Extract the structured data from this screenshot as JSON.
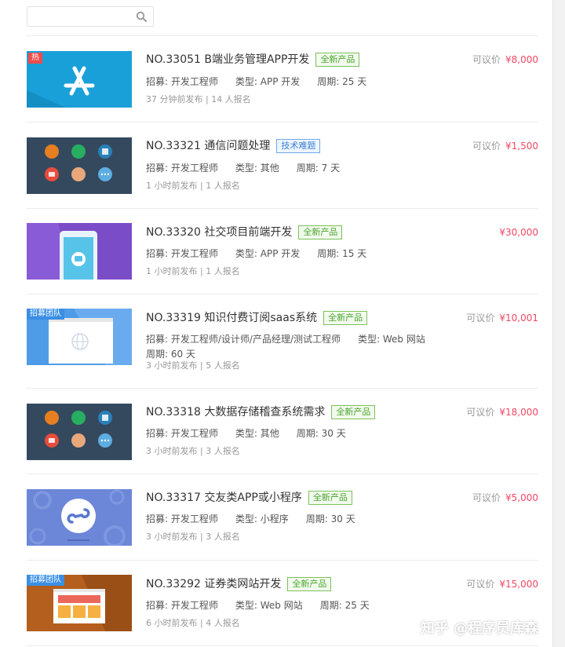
{
  "search": {
    "placeholder": ""
  },
  "watermark": "知乎 @程序员库森",
  "items": [
    {
      "title": "NO.33051 B端业务管理APP开发",
      "badge": "全新产品",
      "badge_type": "new",
      "recruit_label": "招募:",
      "recruit": "开发工程师",
      "type_label": "类型:",
      "type": "APP 开发",
      "period_label": "周期:",
      "period": "25 天",
      "time": "37 分钟前发布 | 14 人报名",
      "price_label": "可议价",
      "price": "¥8,000",
      "thumb_tag": "热",
      "thumb_icon": "app-store-icon",
      "thumb_color": "#1aa0d8"
    },
    {
      "title": "NO.33321 通信问题处理",
      "badge": "技术难题",
      "badge_type": "tech",
      "recruit_label": "招募:",
      "recruit": "开发工程师",
      "type_label": "类型:",
      "type": "其他",
      "period_label": "周期:",
      "period": "7 天",
      "time": "1 小时前发布 | 1 人报名",
      "price_label": "可议价",
      "price": "¥1,500",
      "thumb_icon": "multi-platform-icon",
      "thumb_color": "#34495e"
    },
    {
      "title": "NO.33320 社交项目前端开发",
      "badge": "全新产品",
      "badge_type": "new",
      "recruit_label": "招募:",
      "recruit": "开发工程师",
      "type_label": "类型:",
      "type": "APP 开发",
      "period_label": "周期:",
      "period": "15 天",
      "time": "1 小时前发布 | 1 人报名",
      "price_label": "",
      "price": "¥30,000",
      "thumb_icon": "phone-chat-icon",
      "thumb_color": "#8a5bd6"
    },
    {
      "title": "NO.33319 知识付费订阅saas系统",
      "badge": "全新产品",
      "badge_type": "new",
      "recruit_label": "招募:",
      "recruit": "开发工程师/设计师/产品经理/测试工程师",
      "type_label": "类型:",
      "type": "Web 网站",
      "period_label": "周期:",
      "period": "60 天",
      "time": "3 小时前发布 | 5 人报名",
      "price_label": "可议价",
      "price": "¥10,001",
      "thumb_tag": "招募团队",
      "thumb_icon": "browser-globe-icon",
      "thumb_color": "#4e9be8"
    },
    {
      "title": "NO.33318 大数据存储稽查系统需求",
      "badge": "全新产品",
      "badge_type": "new",
      "recruit_label": "招募:",
      "recruit": "开发工程师",
      "type_label": "类型:",
      "type": "其他",
      "period_label": "周期:",
      "period": "30 天",
      "time": "3 小时前发布 | 3 人报名",
      "price_label": "可议价",
      "price": "¥18,000",
      "thumb_icon": "multi-platform-icon",
      "thumb_color": "#34495e"
    },
    {
      "title": "NO.33317 交友类APP或小程序",
      "badge": "全新产品",
      "badge_type": "new",
      "recruit_label": "招募:",
      "recruit": "开发工程师",
      "type_label": "类型:",
      "type": "小程序",
      "period_label": "周期:",
      "period": "30 天",
      "time": "3 小时前发布 | 3 人报名",
      "price_label": "可议价",
      "price": "¥5,000",
      "thumb_icon": "mini-program-icon",
      "thumb_color": "#6c86d8"
    },
    {
      "title": "NO.33292 证券类网站开发",
      "badge": "全新产品",
      "badge_type": "new",
      "recruit_label": "招募:",
      "recruit": "开发工程师",
      "type_label": "类型:",
      "type": "Web 网站",
      "period_label": "周期:",
      "period": "25 天",
      "time": "6 小时前发布 | 4 人报名",
      "price_label": "可议价",
      "price": "¥15,000",
      "thumb_tag": "招募团队",
      "thumb_icon": "website-layout-icon",
      "thumb_color": "#b45f1e"
    }
  ]
}
